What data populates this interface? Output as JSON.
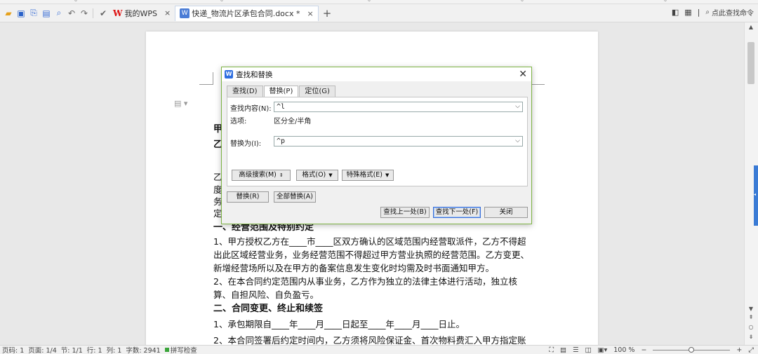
{
  "ruler": {
    "marks": [
      "6",
      "6",
      "6",
      "6",
      "6"
    ]
  },
  "tabbar": {
    "tab_wps": {
      "label": "我的WPS",
      "close": "×"
    },
    "tab_doc": {
      "label": "快递_物流片区承包合同.docx *",
      "close": "×"
    },
    "new_tab": "+",
    "find_command": "点此查找命令"
  },
  "document": {
    "partial_lines": {
      "jia": "甲",
      "yi1": "乙",
      "yi2": "乙",
      "du": "度",
      "wu": "务",
      "ding": "定"
    },
    "section1_heading": "一、经营范围及特别约定",
    "p1": "1、甲方授权乙方在____市____区双方确认的区域范围内经营取派件，乙方不得超出此区域经营业务，业务经营范围不得超过甲方营业执照的经营范围。乙方变更、新增经营场所以及在甲方的备案信息发生变化时均需及时书面通知甲方。",
    "p2": "2、在本合同约定范围内从事业务，乙方作为独立的法律主体进行活动，独立核算、自担风险、自负盈亏。",
    "section2_heading": "二、合同变更、终止和续签",
    "p3": "1、承包期限自____年____月____日起至____年____月____日止。",
    "p4": "2、本合同签署后约定时间内，乙方须将风险保证金、首次物料费汇入甲方指定账"
  },
  "dialog": {
    "title": "查找和替换",
    "close": "✕",
    "tabs": [
      "查找(D)",
      "替换(P)",
      "定位(G)"
    ],
    "active_tab": "替换(P)",
    "find_label": "查找内容(N):",
    "find_value": "^l",
    "options_label": "选项:",
    "options_value": "区分全/半角",
    "replace_label": "替换为(I):",
    "replace_value": "^p",
    "advanced_search": "高级搜索(M)",
    "format": "格式(O)",
    "special_format": "特殊格式(E)",
    "replace_button": "替换(R)",
    "replace_all_button": "全部替换(A)",
    "find_prev_button": "查找上一处(B)",
    "find_next_button": "查找下一处(F)",
    "close_button": "关闭"
  },
  "statusbar": {
    "page_code": "页码: 1",
    "page": "页面: 1/4",
    "section": "节: 1/1",
    "line": "行: 1",
    "column": "列: 1",
    "word_count": "字数: 2941",
    "spell_check": "拼写检查",
    "zoom": "100 %",
    "zoom_minus": "−",
    "zoom_plus": "+",
    "zoom_level": 0.5
  }
}
